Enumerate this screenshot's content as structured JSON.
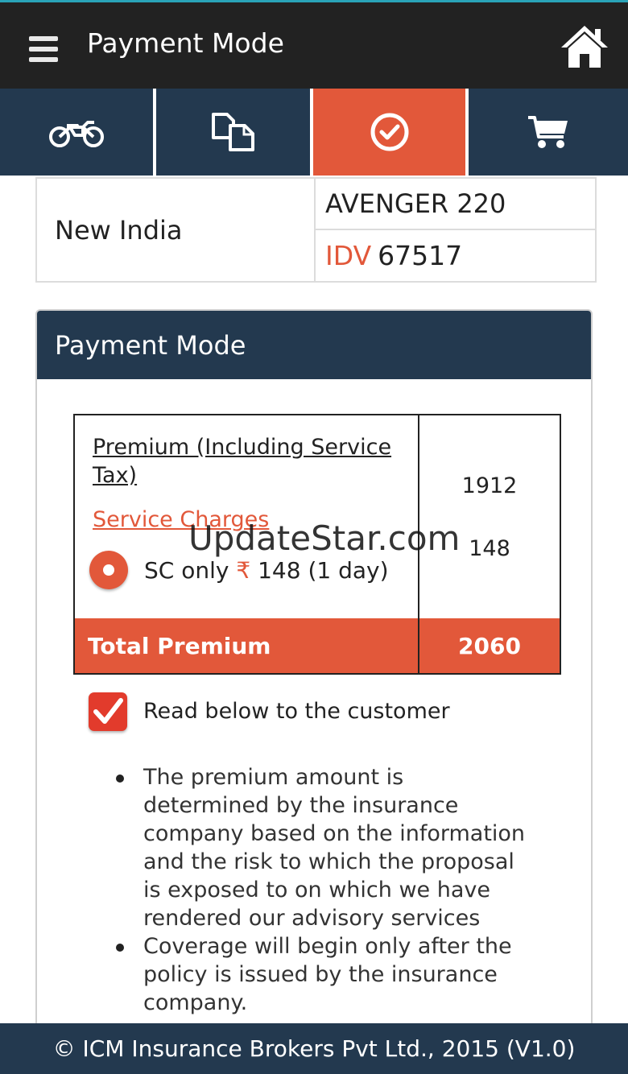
{
  "appbar": {
    "title": "Payment Mode",
    "menu_icon": "hamburger-icon",
    "home_icon": "home-icon"
  },
  "tabs": [
    {
      "icon": "motorcycle-icon",
      "active": false
    },
    {
      "icon": "documents-icon",
      "active": false
    },
    {
      "icon": "check-circle-icon",
      "active": true
    },
    {
      "icon": "cart-icon",
      "active": false
    }
  ],
  "vehicle": {
    "insurer": "New India",
    "model": "AVENGER 220",
    "idv_label": "IDV",
    "idv_value": "67517"
  },
  "panel": {
    "title": "Payment Mode",
    "premium_label": "Premium (Including Service Tax)",
    "premium_value": "1912",
    "service_charges_label": "Service Charges",
    "service_charges_value": "148",
    "sc_option_prefix": "SC only",
    "sc_option_currency": "₹",
    "sc_option_suffix": "148 (1 day)",
    "total_label": "Total Premium",
    "total_value": "2060",
    "read_label": "Read below to the customer",
    "read_checked": true,
    "notes": [
      "The premium amount is determined by the insurance company based on the information and the risk to which the proposal is exposed to on which we have rendered our advisory services",
      "Coverage will begin only after the policy is issued by the insurance company."
    ]
  },
  "watermark": "UpdateStar.com",
  "footer": "© ICM Insurance Brokers Pvt Ltd., 2015 (V1.0)",
  "colors": {
    "accent": "#e2583a",
    "navy": "#23394f",
    "appbar": "#222222"
  }
}
